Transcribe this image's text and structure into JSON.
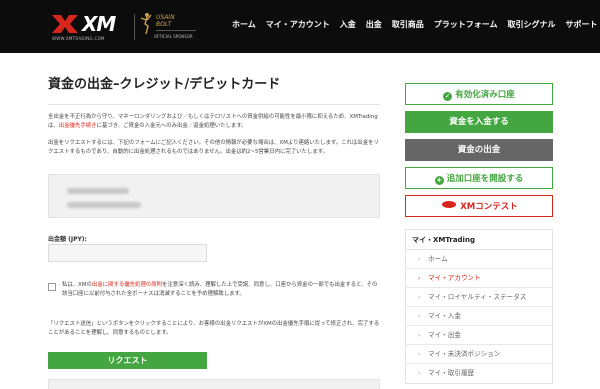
{
  "header": {
    "logo_text": "XM",
    "logo_sub": "WWW.XMTRADING.COM",
    "sponsor_name_1": "USAIN",
    "sponsor_name_2": "BOLT",
    "sponsor_tag": "OFFICIAL SPONSOR",
    "nav": [
      {
        "label": "ホーム"
      },
      {
        "label": "マイ・アカウント"
      },
      {
        "label": "入金"
      },
      {
        "label": "出金"
      },
      {
        "label": "取引商品"
      },
      {
        "label": "プラットフォーム"
      },
      {
        "label": "取引シグナル"
      },
      {
        "label": "サポート"
      }
    ]
  },
  "main": {
    "title": "資金の出金–クレジット/デビットカード",
    "para1_a": "全出金を不正行為から守り、マネーロンダリングおよび／もしくはテロリストへの資金供給の可能性を最小限に抑えるため、XMTradingは、",
    "para1_link": "出金優先手続き",
    "para1_b": "に基づき、ご資金の入金元へのみ出金／返金処理いたします。",
    "para2": "出金をリクエストするには、下記のフォームにご記入ください。その他の情報が必要な場合は、XMより連絡いたします。これは出金をリクエストするものであり、自動的に出金処理されるものではありません。出金は約2~5営業日内に完了いたします。",
    "amount_label": "出金額 (JPY):",
    "amount_value": "",
    "agree_a": "私は、XMの",
    "agree_link": "出金に関する優先処理の原則",
    "agree_b": "を注意深く読み、理解した上で受諾、同意し、口座から資金の一部でも出金すると、その該当口座に以前付与された全ボーナスは消滅することを予め理解致します。",
    "submit_note": "「リクエスト送信」というボタンをクリックすることにより、お客様の出金リクエストがXMの出金優先手順に従って修正され、完了することがあることを理解し、同意するものとします。",
    "submit_label": "リクエスト"
  },
  "sidebar": {
    "btn_valid": "有効化済み口座",
    "btn_deposit": "資金を入金する",
    "btn_withdraw": "資金の出金",
    "btn_add": "追加口座を開設する",
    "btn_contest_badge": "XM",
    "btn_contest": "コンテスト",
    "menu_head": "マイ・XMTrading",
    "menu_items": [
      {
        "label": "ホーム"
      },
      {
        "label": "マイ・アカウント"
      },
      {
        "label": "マイ・ロイヤルティ・ステータス"
      },
      {
        "label": "マイ・入金"
      },
      {
        "label": "マイ・出金"
      },
      {
        "label": "マイ・未決済ポジション"
      },
      {
        "label": "マイ・取引履歴"
      }
    ]
  },
  "colors": {
    "header_bg": "#0c0c0c",
    "accent_red": "#d9261c",
    "accent_green": "#43a640",
    "grey_button": "#666666"
  },
  "icons": {
    "check_circle": "check-circle-icon",
    "plus_circle": "plus-circle-icon",
    "arrow": "chevron-right-icon"
  }
}
